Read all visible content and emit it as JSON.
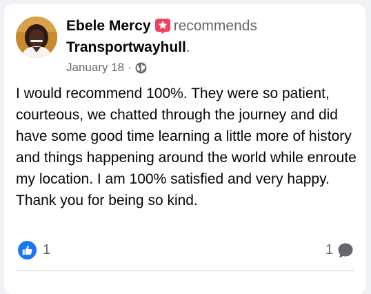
{
  "post": {
    "author": "Ebele Mercy",
    "action": "recommends",
    "page_name": "Transportwayhull",
    "page_dot": ".",
    "date": "January 18",
    "date_separator": "·",
    "privacy_icon": "globe-icon",
    "body": "I would recommend 100%. They were so patient, courteous, we chatted through the journey and did have some good time learning a little more of history and things happening around the world while enroute my location. I am 100% satisfied and very happy. Thank you for being so kind.",
    "recommend_badge_icon": "star-badge-icon",
    "recommend_badge_color": "#f3425f"
  },
  "reactions": {
    "like_icon": "like-icon",
    "like_color": "#1877f2",
    "like_count": "1"
  },
  "comments": {
    "count": "1",
    "icon": "comment-bubble-icon"
  }
}
